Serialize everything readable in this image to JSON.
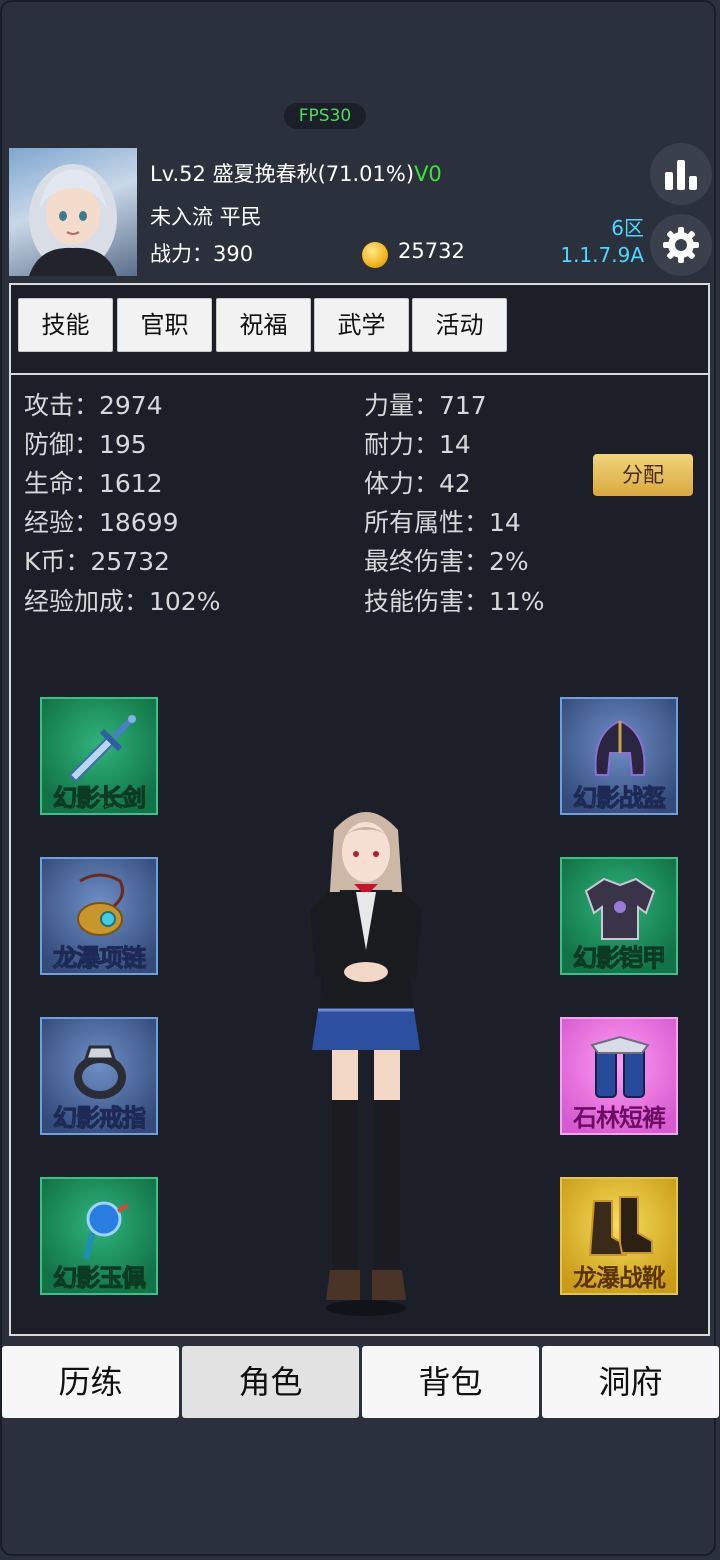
{
  "fps": "FPS30",
  "player": {
    "level": "Lv.52",
    "name": "盛夏挽春秋(71.01%)",
    "vip": "V0",
    "rank": "未入流 平民",
    "power_label": "战力：",
    "power": "390",
    "coins": "25732",
    "server": "6区",
    "version": "1.1.7.9A"
  },
  "tabs": [
    "技能",
    "官职",
    "祝福",
    "武学",
    "活动"
  ],
  "stats": {
    "left": [
      "攻击：2974",
      "防御：195",
      "生命：1612",
      "经验：18699",
      "K币：25732",
      "经验加成：102%"
    ],
    "right": [
      "力量：717",
      "耐力：14",
      "体力：42",
      "所有属性：14",
      "最终伤害：2%",
      "技能伤害：11%"
    ]
  },
  "allocate_label": "分配",
  "equipment": {
    "left": [
      {
        "name": "幻影长剑",
        "icon": "sword-icon",
        "rarity": "green"
      },
      {
        "name": "龙瀑项链",
        "icon": "necklace-icon",
        "rarity": "blue"
      },
      {
        "name": "幻影戒指",
        "icon": "ring-icon",
        "rarity": "blue"
      },
      {
        "name": "幻影玉佩",
        "icon": "jade-pendant-icon",
        "rarity": "green"
      }
    ],
    "right": [
      {
        "name": "幻影战盔",
        "icon": "helmet-icon",
        "rarity": "blue"
      },
      {
        "name": "幻影铠甲",
        "icon": "armor-icon",
        "rarity": "green"
      },
      {
        "name": "石林短裤",
        "icon": "shorts-icon",
        "rarity": "pink"
      },
      {
        "name": "龙瀑战靴",
        "icon": "boots-icon",
        "rarity": "gold"
      }
    ]
  },
  "nav": [
    "历练",
    "角色",
    "背包",
    "洞府"
  ],
  "nav_active": 1,
  "colors": {
    "vip": "#3fe03a",
    "server": "#4fd6ff",
    "fps": "#4cd964"
  }
}
